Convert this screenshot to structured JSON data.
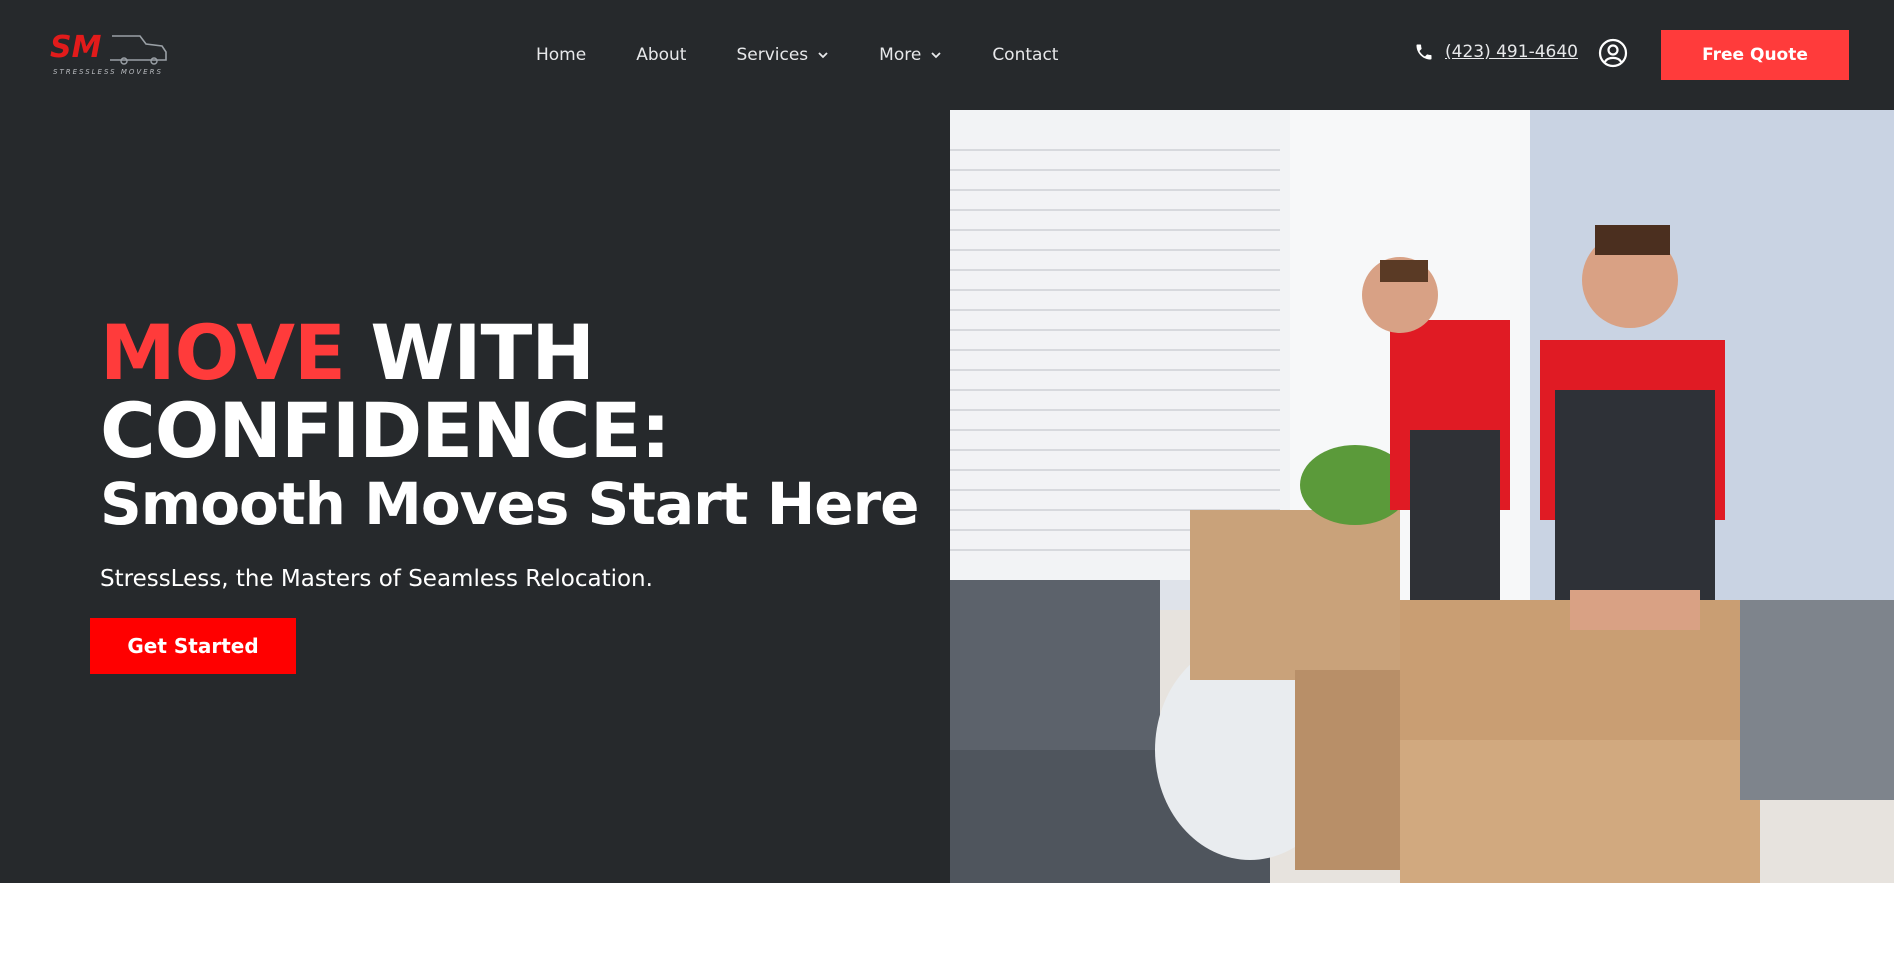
{
  "brand": {
    "logo_letters": "SM",
    "logo_tagline": "STRESSLESS MOVERS",
    "colors": {
      "accent": "#ff3b3b",
      "cta": "#ff0000",
      "dark": "#26292c"
    }
  },
  "nav": {
    "items": [
      {
        "label": "Home",
        "dropdown": false
      },
      {
        "label": "About",
        "dropdown": false
      },
      {
        "label": "Services",
        "dropdown": true
      },
      {
        "label": "More",
        "dropdown": true
      },
      {
        "label": "Contact",
        "dropdown": false
      }
    ]
  },
  "header": {
    "phone": "(423) 491-4640",
    "phone_icon": "phone-icon",
    "account_icon": "user-circle-icon",
    "quote_label": "Free Quote"
  },
  "hero": {
    "headline_accent": "MOVE",
    "headline_rest": " WITH",
    "headline_line2": "CONFIDENCE:",
    "subheadline": "Smooth Moves Start Here",
    "tagline": "StressLess, the Masters of Seamless Relocation.",
    "cta_label": "Get Started",
    "photo": "two movers in red shirts packing cardboard boxes"
  }
}
